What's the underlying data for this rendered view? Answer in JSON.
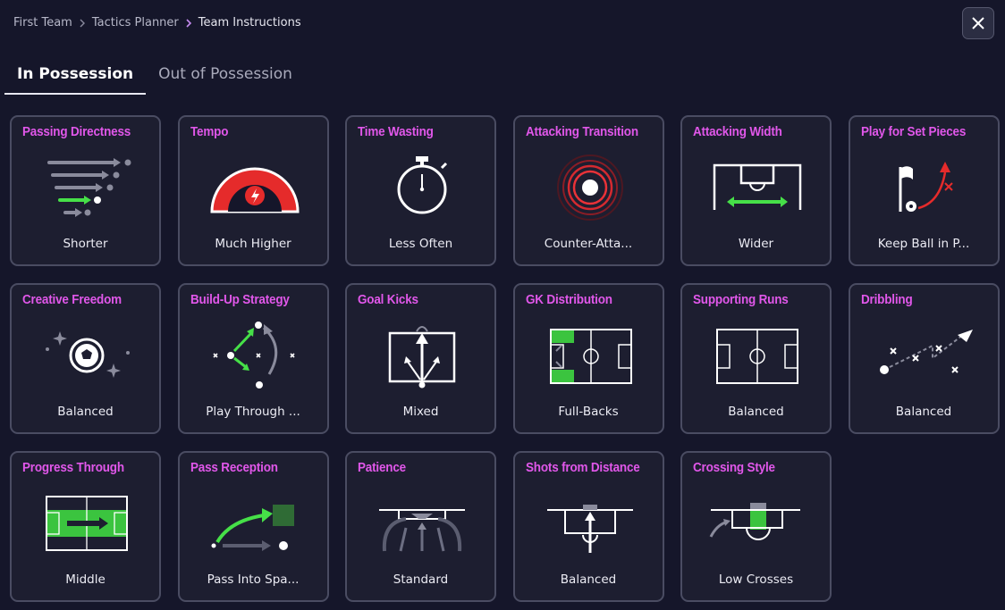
{
  "breadcrumb": [
    "First Team",
    "Tactics Planner",
    "Team Instructions"
  ],
  "tabs": [
    {
      "label": "In Possession",
      "active": true
    },
    {
      "label": "Out of Possession",
      "active": false
    }
  ],
  "cards": [
    {
      "title": "Passing Directness",
      "value": "Shorter",
      "icon": "passing-directness-icon"
    },
    {
      "title": "Tempo",
      "value": "Much Higher",
      "icon": "tempo-gauge-icon"
    },
    {
      "title": "Time Wasting",
      "value": "Less Often",
      "icon": "stopwatch-icon"
    },
    {
      "title": "Attacking Transition",
      "value": "Counter-Atta...",
      "icon": "counter-attack-icon"
    },
    {
      "title": "Attacking Width",
      "value": "Wider",
      "icon": "pitch-width-icon"
    },
    {
      "title": "Play for Set Pieces",
      "value": "Keep Ball in P...",
      "icon": "corner-flag-icon"
    },
    {
      "title": "Creative Freedom",
      "value": "Balanced",
      "icon": "sparkle-ball-icon"
    },
    {
      "title": "Build-Up Strategy",
      "value": "Play Through ...",
      "icon": "build-up-icon"
    },
    {
      "title": "Goal Kicks",
      "value": "Mixed",
      "icon": "goal-kick-icon"
    },
    {
      "title": "GK Distribution",
      "value": "Full-Backs",
      "icon": "gk-distribution-icon"
    },
    {
      "title": "Supporting Runs",
      "value": "Balanced",
      "icon": "supporting-runs-icon"
    },
    {
      "title": "Dribbling",
      "value": "Balanced",
      "icon": "dribbling-icon"
    },
    {
      "title": "Progress Through",
      "value": "Middle",
      "icon": "progress-middle-icon"
    },
    {
      "title": "Pass Reception",
      "value": "Pass Into Spa...",
      "icon": "pass-reception-icon"
    },
    {
      "title": "Patience",
      "value": "Standard",
      "icon": "patience-icon"
    },
    {
      "title": "Shots from Distance",
      "value": "Balanced",
      "icon": "shots-distance-icon"
    },
    {
      "title": "Crossing Style",
      "value": "Low Crosses",
      "icon": "crossing-style-icon"
    }
  ],
  "colors": {
    "background": "#15162a",
    "card": "#1d1e30",
    "card_border": "#4a4c62",
    "title_accent": "#e157ea",
    "highlight_green": "#46e048",
    "tempo_red": "#e52b2b"
  }
}
